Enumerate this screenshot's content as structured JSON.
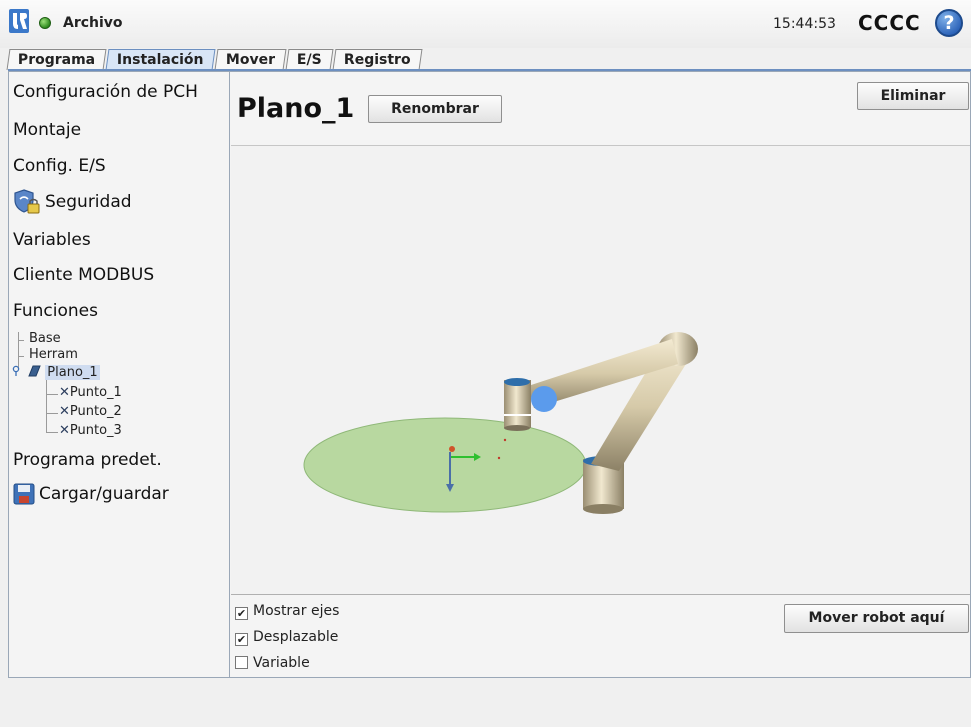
{
  "header": {
    "app_title": "Archivo",
    "clock": "15:44:53",
    "robot_name": "CCCC",
    "help_label": "?"
  },
  "tabs": [
    {
      "label": "Programa"
    },
    {
      "label": "Instalación",
      "active": true
    },
    {
      "label": "Mover"
    },
    {
      "label": "E/S"
    },
    {
      "label": "Registro"
    }
  ],
  "sidebar": {
    "items": [
      {
        "label": "Configuración de PCH"
      },
      {
        "label": "Montaje"
      },
      {
        "label": "Config. E/S"
      },
      {
        "label": "Seguridad",
        "icon": "shield-lock-icon"
      },
      {
        "label": "Variables"
      },
      {
        "label": "Cliente MODBUS"
      },
      {
        "label": "Funciones"
      },
      {
        "label": "Programa predet."
      },
      {
        "label": "Cargar/guardar",
        "icon": "floppy-disk-icon"
      }
    ],
    "tree": {
      "base": "Base",
      "tool": "Herram",
      "plane": "Plano_1",
      "points": [
        "Punto_1",
        "Punto_2",
        "Punto_3"
      ]
    }
  },
  "main": {
    "feature_name": "Plano_1",
    "rename_label": "Renombrar",
    "delete_label": "Eliminar",
    "move_here_label": "Mover robot aquí",
    "options": [
      {
        "label": "Mostrar ejes",
        "checked": true
      },
      {
        "label": "Desplazable",
        "checked": true
      },
      {
        "label": "Variable",
        "checked": false
      }
    ],
    "check_mark": "✔"
  },
  "colors": {
    "accent": "#6c8fc0",
    "plane_fill": "#b8d8a0",
    "robot_body": "#e0d4b4",
    "joint_cap": "#2e6eaa",
    "status_ok": "#2e8a1e"
  }
}
